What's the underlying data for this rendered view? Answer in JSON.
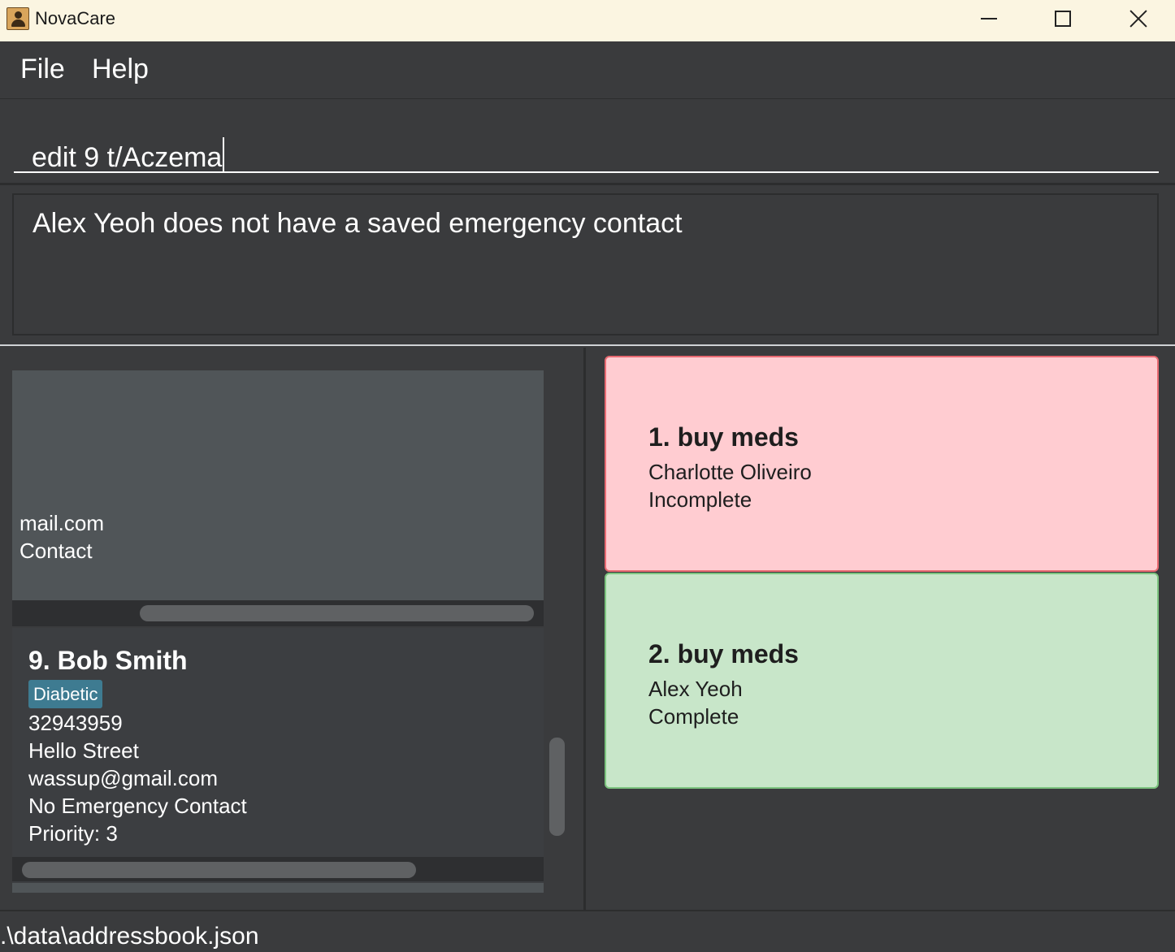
{
  "window": {
    "title": "NovaCare",
    "controls": [
      "minimize",
      "maximize",
      "close"
    ]
  },
  "menu": {
    "file_label": "File",
    "help_label": "Help"
  },
  "command": {
    "value": "edit 9 t/Aczema"
  },
  "result": {
    "message": "Alex Yeoh does not have a saved emergency contact"
  },
  "persons": {
    "partial_card": {
      "line1": "mail.com",
      "line2": "Contact"
    },
    "bob": {
      "name": "9. Bob Smith",
      "tag": "Diabetic",
      "phone": "32943959",
      "address": "Hello Street",
      "email": "wassup@gmail.com",
      "emergency": "No Emergency Contact",
      "priority": "Priority: 3"
    }
  },
  "tasks": [
    {
      "title": "1. buy meds",
      "person": "Charlotte Oliveiro",
      "status": "Incomplete",
      "color": "#ffccd1"
    },
    {
      "title": "2. buy meds",
      "person": "Alex Yeoh",
      "status": "Complete",
      "color": "#c8e6c9"
    }
  ],
  "status_bar": {
    "path": ".\\data\\addressbook.json"
  },
  "colors": {
    "background": "#3a3b3d",
    "tag": "#3e7b91",
    "titlebar": "#fbf5e1"
  }
}
